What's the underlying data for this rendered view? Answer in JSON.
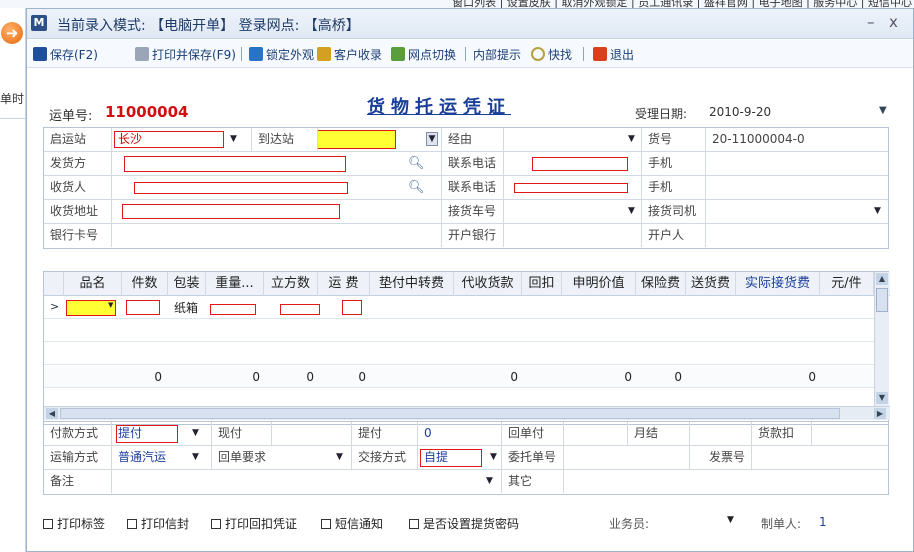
{
  "top_menu": "窗口列表 | 设置皮肤 | 取消外观锁定 | 员工通讯录 | 盛祥官网 | 电子地图 | 服务中心 | 短信中心",
  "left_pane": {
    "label": "单时"
  },
  "window": {
    "title": "当前录入模式: 【电脑开单】 登录网点: 【高桥】",
    "minimize": "–",
    "close": "x"
  },
  "toolbar": {
    "save": "保存(F2)",
    "print_save": "打印并保存(F9)",
    "lock_look": "锁定外观",
    "customer_receipt": "客户收录",
    "switch_outlet": "网点切换",
    "internal_tip": "内部提示",
    "quick_find": "快找",
    "exit": "退出"
  },
  "form": {
    "waybill_label": "运单号:",
    "waybill_no": "11000004",
    "title": "货物托运凭证",
    "date_label": "受理日期:",
    "date_value": "2010-9-20"
  },
  "fields": {
    "origin_label": "启运站",
    "origin_value": "长沙",
    "dest_label": "到达站",
    "via_label": "经由",
    "goods_no_label": "货号",
    "goods_no_value": "20-11000004-0",
    "shipper_label": "发货方",
    "phone1_label": "联系电话",
    "mobile1_label": "手机",
    "consignee_label": "收货人",
    "phone2_label": "联系电话",
    "mobile2_label": "手机",
    "address_label": "收货地址",
    "truck_label": "接货车号",
    "driver_label": "接货司机",
    "bank_card_label": "银行卡号",
    "bank_label": "开户银行",
    "holder_label": "开户人"
  },
  "lines": {
    "headers": [
      "品名",
      "件数",
      "包装",
      "重量...",
      "立方数",
      "运 费",
      "垫付中转费",
      "代收货款",
      "回扣",
      "申明价值",
      "保险费",
      "送货费",
      "实际接货费",
      "元/件"
    ],
    "row1_pack": "纸箱",
    "totals": [
      "0",
      "0",
      "0",
      "0",
      "0",
      "0",
      "0",
      "0"
    ]
  },
  "bottom": {
    "pay_label": "付款方式",
    "pay_value": "提付",
    "cash_label": "现付",
    "pickup_label": "提付",
    "pickup_value": "0",
    "return_pay_label": "回单付",
    "monthly_label": "月结",
    "loan_deduct_label": "货款扣",
    "transport_label": "运输方式",
    "transport_value": "普通汽运",
    "return_req_label": "回单要求",
    "handover_label": "交接方式",
    "handover_value": "自提",
    "consign_no_label": "委托单号",
    "invoice_label": "发票号",
    "remark_label": "备注",
    "other_label": "其它"
  },
  "footer": {
    "print_label": "打印标签",
    "print_letter": "打印信封",
    "print_return": "打印回扣凭证",
    "sms": "短信通知",
    "pickup_pwd": "是否设置提货密码",
    "salesman_label": "业务员:",
    "maker_label": "制单人:",
    "maker_value": "1"
  }
}
